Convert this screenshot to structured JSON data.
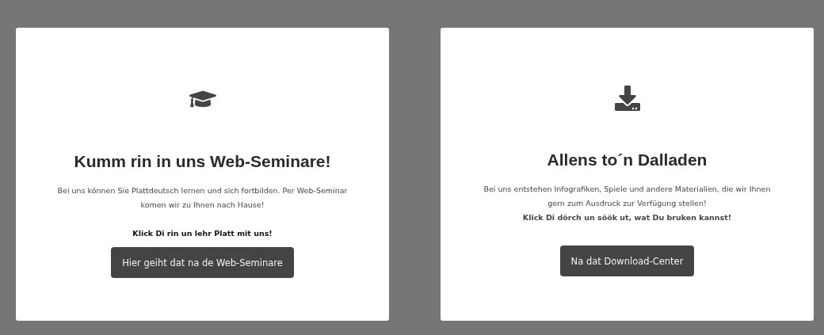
{
  "cards": [
    {
      "kind": "seminar",
      "title": "Kumm rin in uns Web-Seminare!",
      "paragraphs": [
        {
          "kind": "plain",
          "lines": [
            "Bei uns können Sie Plattdeutsch lernen und sich fortbilden. Per Web-Seminar komen wir zu Ihnen nach Hause!"
          ]
        },
        {
          "kind": "bold",
          "lines": [
            "Klick Di rin un lehr Platt mit uns!"
          ]
        }
      ],
      "button": "Hier geiht dat na de Web-Seminare"
    },
    {
      "kind": "download",
      "title": "Allens to´n Dalladen",
      "paragraphs": [
        {
          "kind": "plain",
          "lines": [
            "Bei uns entstehen Infografiken, Spiele und andere Materialien, die wir Ihnen gern zum Ausdruck zur Verfügung stellen!",
            "**Klick Di dörch un söök ut, wat Du bruken kannst!**"
          ]
        }
      ],
      "button": "Na dat Download-Center"
    }
  ]
}
